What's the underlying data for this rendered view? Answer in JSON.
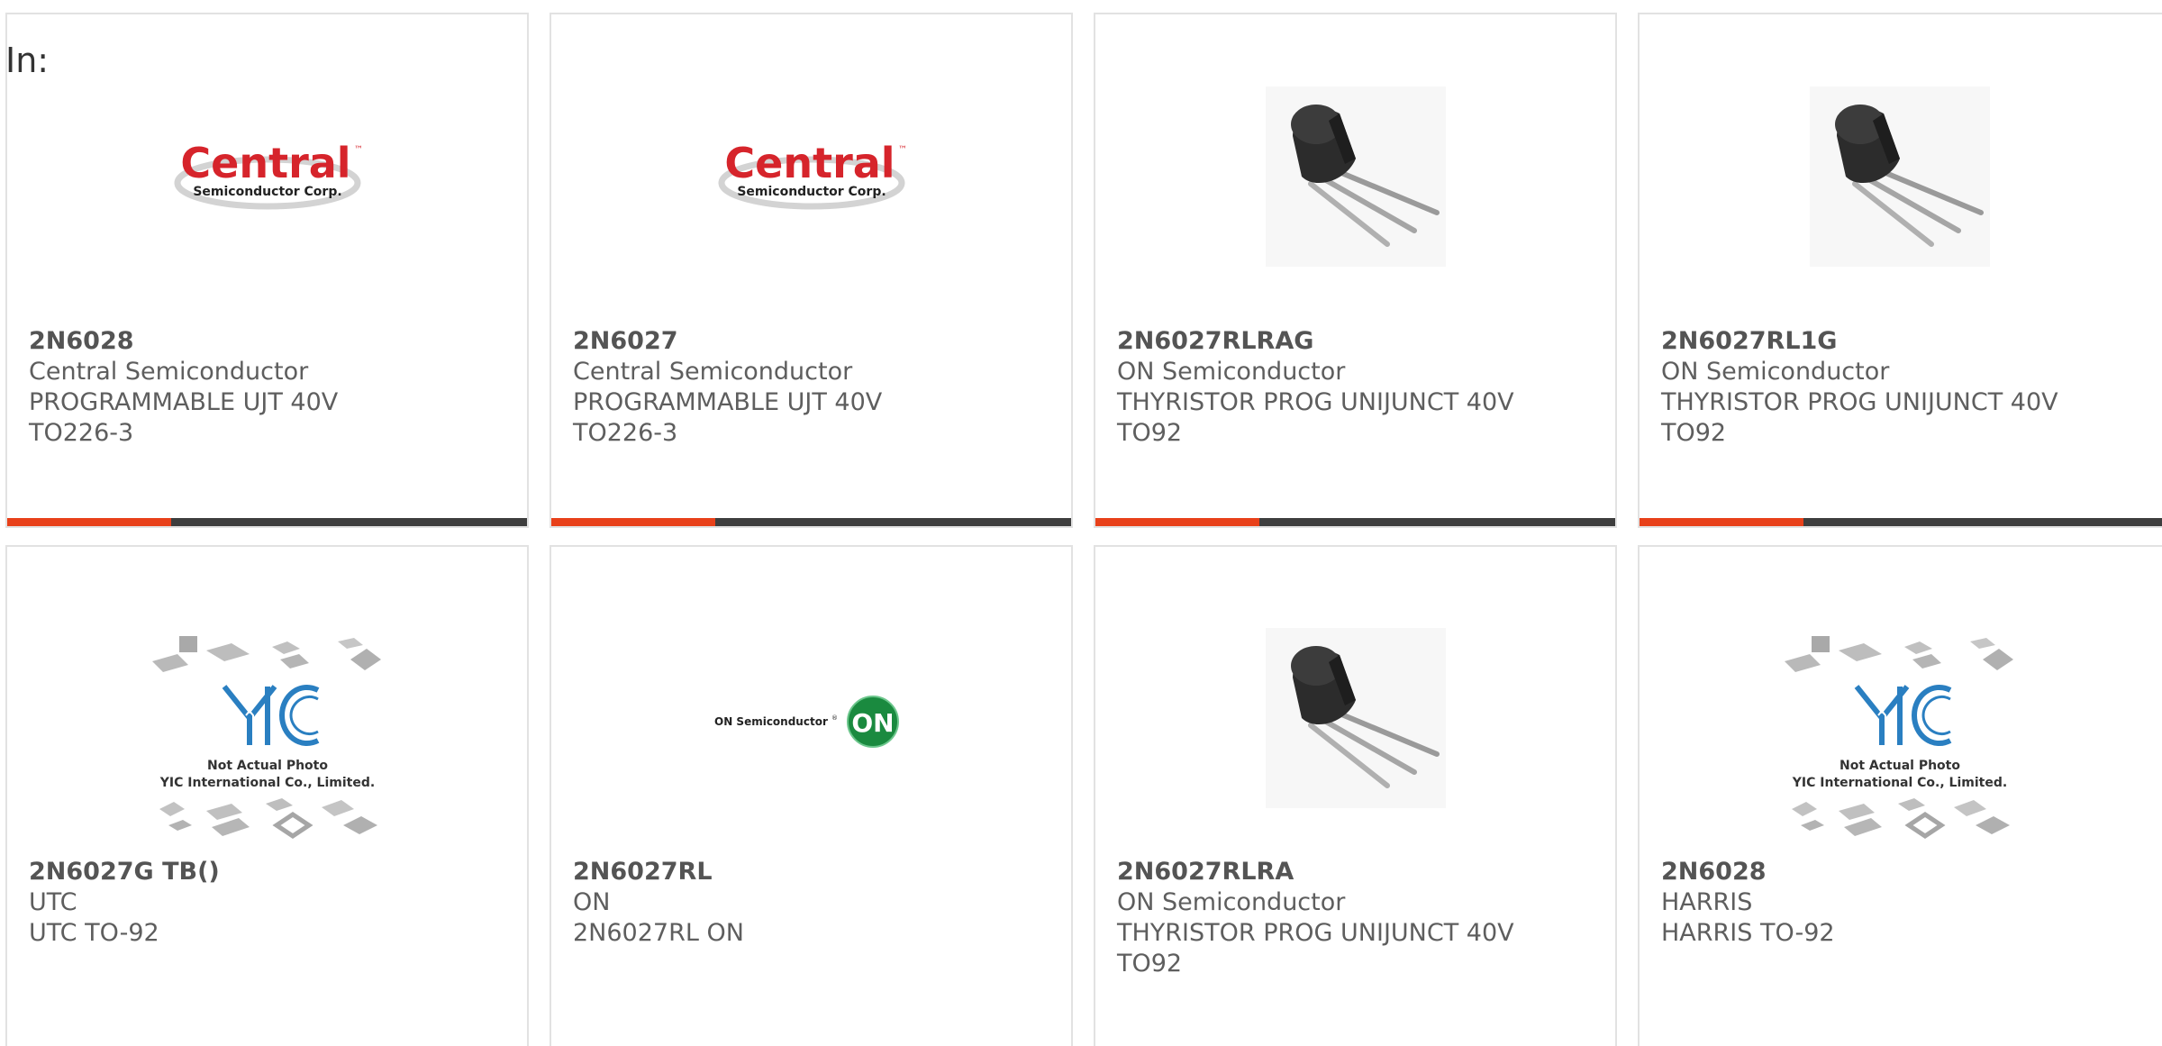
{
  "filter": {
    "label": "In:"
  },
  "colors": {
    "accent": "#e8411a",
    "bar_dark": "#3e3e3e",
    "text": "#5e5e5e",
    "central_red": "#d6242b",
    "on_green": "#1a8a3f",
    "yic_blue": "#2a7fc1"
  },
  "products": [
    {
      "part_number": "2N6028",
      "manufacturer": "Central Semiconductor",
      "description": "PROGRAMMABLE UJT 40V",
      "package": "TO226-3",
      "image": "central-semiconductor-logo",
      "logo_main": "Central",
      "logo_sub": "Semiconductor Corp.",
      "logo_tm": "™"
    },
    {
      "part_number": "2N6027",
      "manufacturer": "Central Semiconductor",
      "description": "PROGRAMMABLE UJT 40V",
      "package": "TO226-3",
      "image": "central-semiconductor-logo",
      "logo_main": "Central",
      "logo_sub": "Semiconductor Corp.",
      "logo_tm": "™"
    },
    {
      "part_number": "2N6027RLRAG",
      "manufacturer": "ON Semiconductor",
      "description": "THYRISTOR PROG UNIJUNCT 40V",
      "package": "TO92",
      "image": "to92-transistor-photo"
    },
    {
      "part_number": "2N6027RL1G",
      "manufacturer": "ON Semiconductor",
      "description": "THYRISTOR PROG UNIJUNCT 40V",
      "package": "TO92",
      "image": "to92-transistor-photo"
    },
    {
      "part_number": "2N6027G TB()",
      "manufacturer": "UTC",
      "description": "UTC TO-92",
      "image": "yic-not-actual-photo",
      "photo_line1": "Not Actual Photo",
      "photo_line2": "YIC International Co., Limited."
    },
    {
      "part_number": "2N6027RL",
      "manufacturer": "ON",
      "description": "2N6027RL ON",
      "image": "on-semiconductor-logo",
      "logo_text": "ON Semiconductor",
      "logo_tm": "®",
      "logo_badge": "ON"
    },
    {
      "part_number": "2N6027RLRA",
      "manufacturer": "ON Semiconductor",
      "description": "THYRISTOR PROG UNIJUNCT 40V",
      "package": "TO92",
      "image": "to92-transistor-photo"
    },
    {
      "part_number": "2N6028",
      "manufacturer": "HARRIS",
      "description": "HARRIS TO-92",
      "image": "yic-not-actual-photo",
      "photo_line1": "Not Actual Photo",
      "photo_line2": "YIC International Co., Limited."
    }
  ]
}
